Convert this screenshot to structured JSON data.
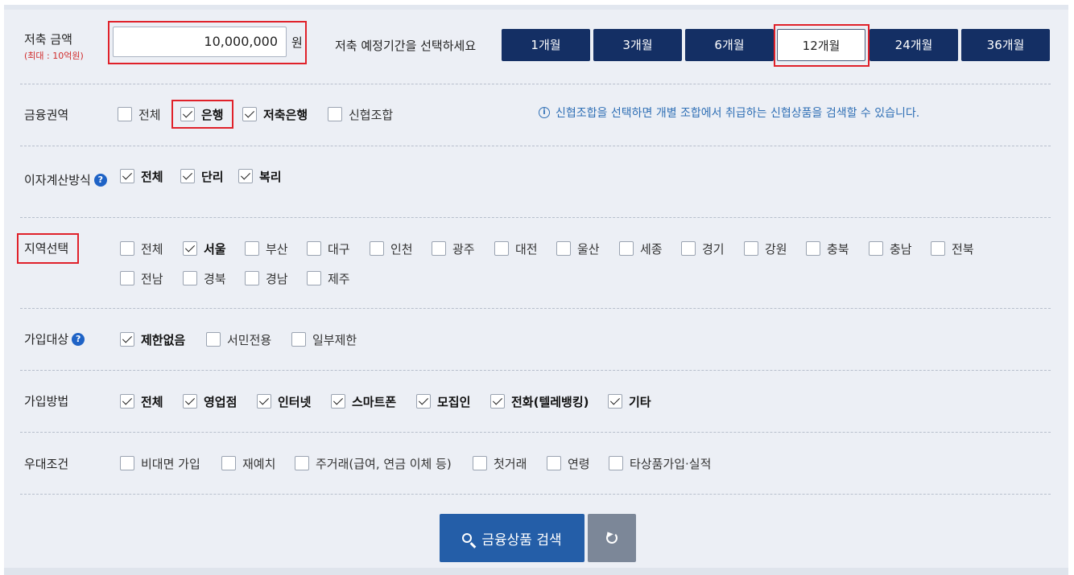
{
  "amount": {
    "label": "저축 금액",
    "sublabel": "(최대 : 10억원)",
    "value": "10,000,000",
    "unit": "원"
  },
  "period": {
    "label": "저축 예정기간을 선택하세요",
    "options": [
      "1개월",
      "3개월",
      "6개월",
      "12개월",
      "24개월",
      "36개월"
    ],
    "selected": "12개월"
  },
  "sector": {
    "label": "금융권역",
    "options": [
      {
        "text": "전체",
        "checked": false
      },
      {
        "text": "은행",
        "checked": true
      },
      {
        "text": "저축은행",
        "checked": true
      },
      {
        "text": "신협조합",
        "checked": false
      }
    ],
    "note": "신협조합을 선택하면 개별 조합에서 취급하는 신협상품을 검색할 수 있습니다."
  },
  "interest": {
    "label": "이자계산방식",
    "options": [
      {
        "text": "전체",
        "checked": true
      },
      {
        "text": "단리",
        "checked": true
      },
      {
        "text": "복리",
        "checked": true
      }
    ]
  },
  "region": {
    "label": "지역선택",
    "options": [
      {
        "text": "전체",
        "checked": false
      },
      {
        "text": "서울",
        "checked": true
      },
      {
        "text": "부산",
        "checked": false
      },
      {
        "text": "대구",
        "checked": false
      },
      {
        "text": "인천",
        "checked": false
      },
      {
        "text": "광주",
        "checked": false
      },
      {
        "text": "대전",
        "checked": false
      },
      {
        "text": "울산",
        "checked": false
      },
      {
        "text": "세종",
        "checked": false
      },
      {
        "text": "경기",
        "checked": false
      },
      {
        "text": "강원",
        "checked": false
      },
      {
        "text": "충북",
        "checked": false
      },
      {
        "text": "충남",
        "checked": false
      },
      {
        "text": "전북",
        "checked": false
      },
      {
        "text": "전남",
        "checked": false
      },
      {
        "text": "경북",
        "checked": false
      },
      {
        "text": "경남",
        "checked": false
      },
      {
        "text": "제주",
        "checked": false
      }
    ]
  },
  "target": {
    "label": "가입대상",
    "options": [
      {
        "text": "제한없음",
        "checked": true
      },
      {
        "text": "서민전용",
        "checked": false
      },
      {
        "text": "일부제한",
        "checked": false
      }
    ]
  },
  "method": {
    "label": "가입방법",
    "options": [
      {
        "text": "전체",
        "checked": true
      },
      {
        "text": "영업점",
        "checked": true
      },
      {
        "text": "인터넷",
        "checked": true
      },
      {
        "text": "스마트폰",
        "checked": true
      },
      {
        "text": "모집인",
        "checked": true
      },
      {
        "text": "전화(텔레뱅킹)",
        "checked": true
      },
      {
        "text": "기타",
        "checked": true
      }
    ]
  },
  "preferential": {
    "label": "우대조건",
    "options": [
      {
        "text": "비대면 가입",
        "checked": false
      },
      {
        "text": "재예치",
        "checked": false
      },
      {
        "text": "주거래(급여, 연금 이체 등)",
        "checked": false
      },
      {
        "text": "첫거래",
        "checked": false
      },
      {
        "text": "연령",
        "checked": false
      },
      {
        "text": "타상품가입·실적",
        "checked": false
      }
    ]
  },
  "help_glyph": "?",
  "info_glyph": "i",
  "buttons": {
    "search_label": "금융상품 검색"
  },
  "colors": {
    "navy": "#142f64",
    "search_blue": "#245ea8",
    "reset_gray": "#7c8798",
    "highlight_red": "#e0212a",
    "note_blue": "#2f6fb5"
  }
}
